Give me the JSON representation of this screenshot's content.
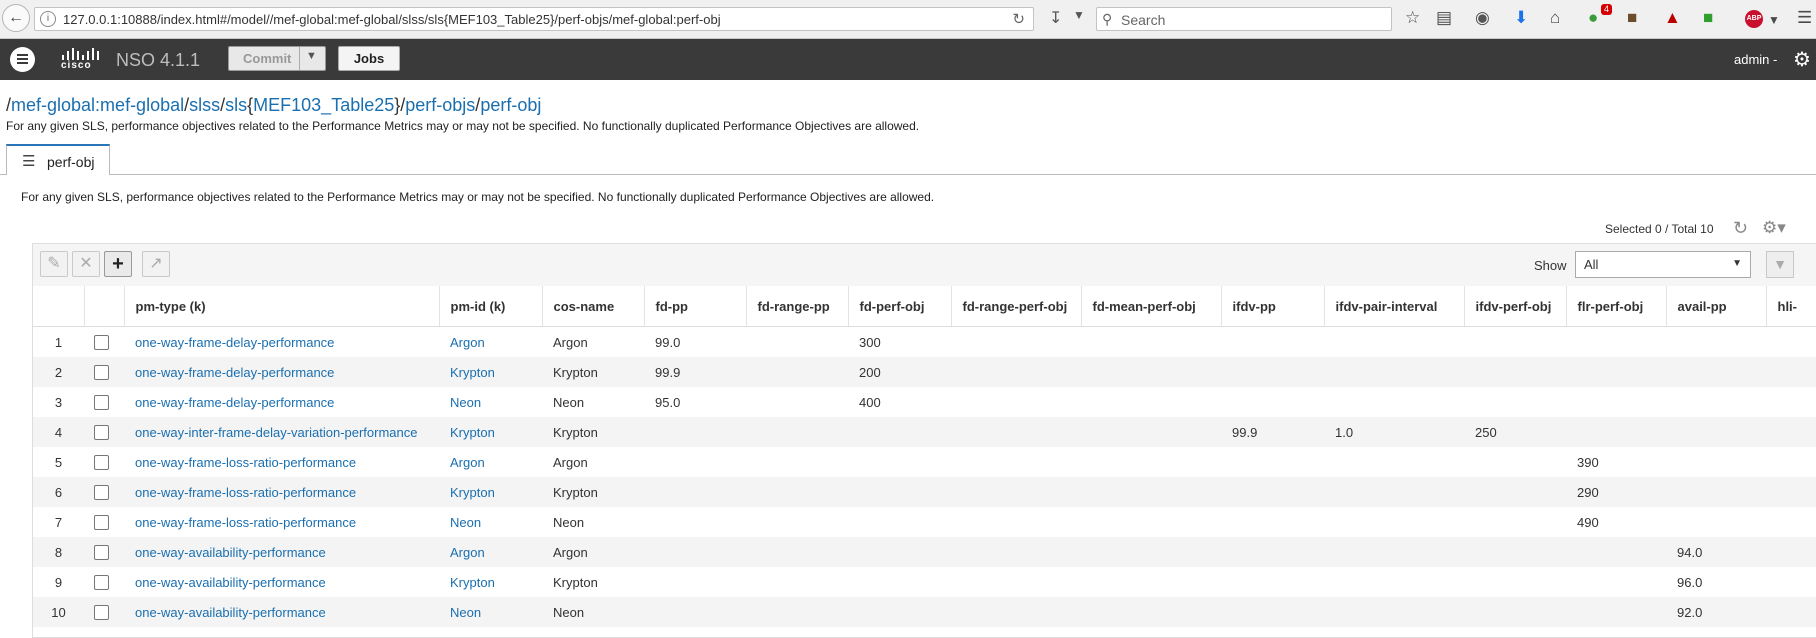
{
  "browser": {
    "url": "127.0.0.1:10888/index.html#/model//mef-global:mef-global/slss/sls{MEF103_Table25}/perf-objs/mef-global:perf-obj",
    "search_placeholder": "Search",
    "notification_count": "4",
    "adblock_label": "ABP"
  },
  "app": {
    "brand": "cisco",
    "title": "NSO 4.1.1",
    "commit_label": "Commit",
    "jobs_label": "Jobs",
    "user_label": "admin -"
  },
  "breadcrumb": {
    "seg1": "mef-global:mef-global",
    "seg2": "slss",
    "seg3": "sls",
    "seg4": "MEF103_Table25",
    "seg5": "perf-objs",
    "seg6": "perf-obj"
  },
  "description": "For any given SLS, performance objectives related to the Performance Metrics may or may not be specified. No functionally duplicated Performance Objectives are allowed.",
  "tab": {
    "label": "perf-obj"
  },
  "panel": {
    "description": "For any given SLS, performance objectives related to the Performance Metrics may or may not be specified. No functionally duplicated Performance Objectives are allowed.",
    "selection": "Selected 0 / Total 10",
    "show_label": "Show",
    "show_value": "All"
  },
  "table": {
    "columns": [
      "",
      "",
      "pm-type  (k)",
      "pm-id  (k)",
      "cos-name",
      "fd-pp",
      "fd-range-pp",
      "fd-perf-obj",
      "fd-range-perf-obj",
      "fd-mean-perf-obj",
      "ifdv-pp",
      "ifdv-pair-interval",
      "ifdv-perf-obj",
      "flr-perf-obj",
      "avail-pp",
      "hli-"
    ],
    "rows": [
      [
        "1",
        "",
        "one-way-frame-delay-performance",
        "Argon",
        "Argon",
        "99.0",
        "",
        "300",
        "",
        "",
        "",
        "",
        "",
        "",
        "",
        ""
      ],
      [
        "2",
        "",
        "one-way-frame-delay-performance",
        "Krypton",
        "Krypton",
        "99.9",
        "",
        "200",
        "",
        "",
        "",
        "",
        "",
        "",
        "",
        ""
      ],
      [
        "3",
        "",
        "one-way-frame-delay-performance",
        "Neon",
        "Neon",
        "95.0",
        "",
        "400",
        "",
        "",
        "",
        "",
        "",
        "",
        "",
        ""
      ],
      [
        "4",
        "",
        "one-way-inter-frame-delay-variation-performance",
        "Krypton",
        "Krypton",
        "",
        "",
        "",
        "",
        "",
        "99.9",
        "1.0",
        "250",
        "",
        "",
        ""
      ],
      [
        "5",
        "",
        "one-way-frame-loss-ratio-performance",
        "Argon",
        "Argon",
        "",
        "",
        "",
        "",
        "",
        "",
        "",
        "",
        "390",
        "",
        ""
      ],
      [
        "6",
        "",
        "one-way-frame-loss-ratio-performance",
        "Krypton",
        "Krypton",
        "",
        "",
        "",
        "",
        "",
        "",
        "",
        "",
        "290",
        "",
        ""
      ],
      [
        "7",
        "",
        "one-way-frame-loss-ratio-performance",
        "Neon",
        "Neon",
        "",
        "",
        "",
        "",
        "",
        "",
        "",
        "",
        "490",
        "",
        ""
      ],
      [
        "8",
        "",
        "one-way-availability-performance",
        "Argon",
        "Argon",
        "",
        "",
        "",
        "",
        "",
        "",
        "",
        "",
        "",
        "94.0",
        ""
      ],
      [
        "9",
        "",
        "one-way-availability-performance",
        "Krypton",
        "Krypton",
        "",
        "",
        "",
        "",
        "",
        "",
        "",
        "",
        "",
        "96.0",
        ""
      ],
      [
        "10",
        "",
        "one-way-availability-performance",
        "Neon",
        "Neon",
        "",
        "",
        "",
        "",
        "",
        "",
        "",
        "",
        "",
        "92.0",
        ""
      ]
    ]
  }
}
